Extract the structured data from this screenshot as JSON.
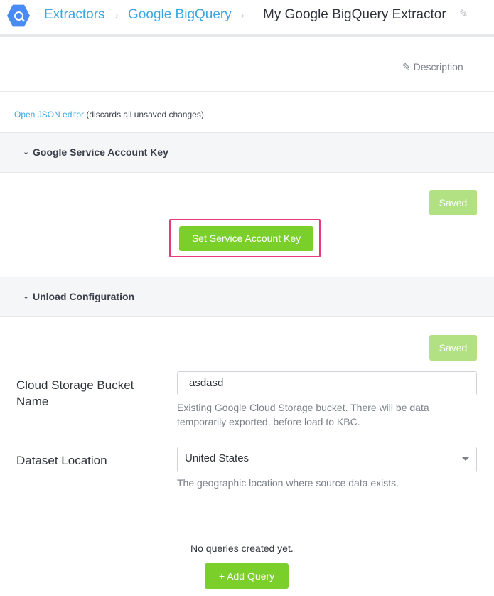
{
  "header": {
    "breadcrumbs": [
      "Extractors",
      "Google BigQuery"
    ],
    "title": "My Google BigQuery Extractor"
  },
  "description_link": "Description",
  "json_editor": {
    "link": "Open JSON editor",
    "note": "(discards all unsaved changes)"
  },
  "sections": {
    "service_account": {
      "title": "Google Service Account Key",
      "saved_label": "Saved",
      "set_key_label": "Set Service Account Key"
    },
    "unload": {
      "title": "Unload Configuration",
      "saved_label": "Saved",
      "bucket": {
        "label": "Cloud Storage Bucket Name",
        "value": "asdasd",
        "help": "Existing Google Cloud Storage bucket. There will be data temporarily exported, before load to KBC."
      },
      "location": {
        "label": "Dataset Location",
        "value": "United States",
        "help": "The geographic location where source data exists."
      }
    }
  },
  "queries": {
    "empty_text": "No queries created yet.",
    "add_label": "Add Query"
  },
  "colors": {
    "accent_link": "#3aa7e2",
    "primary_button": "#7bcf2b",
    "saved_button": "#b1e183",
    "highlight": "#e8397d"
  }
}
